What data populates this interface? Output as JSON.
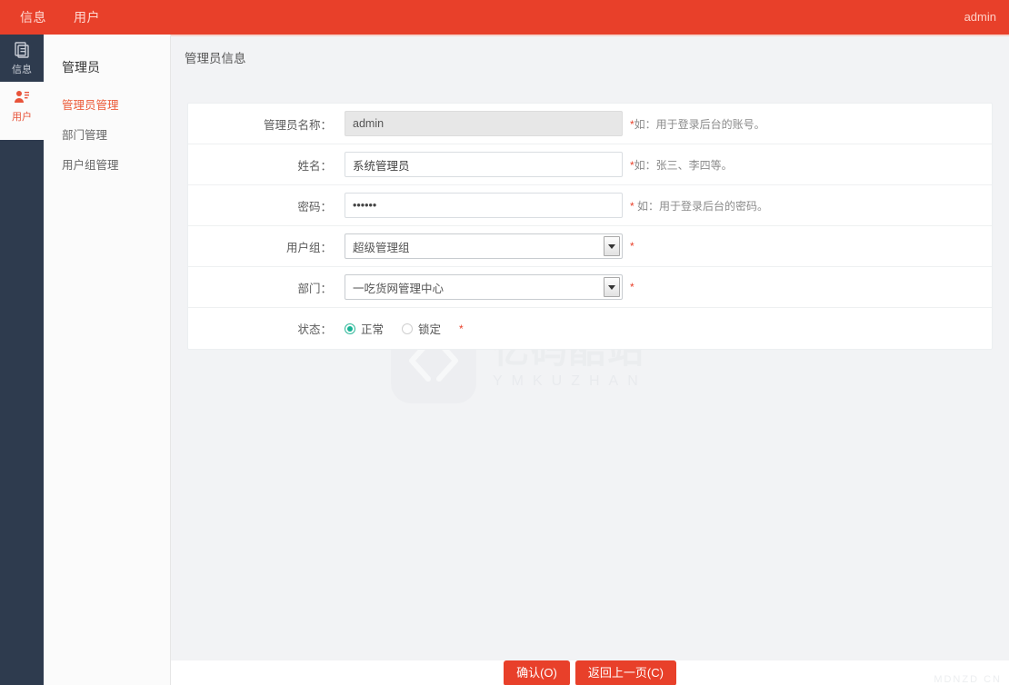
{
  "header": {
    "nav": [
      {
        "label": "信息",
        "icon": "info-tab"
      },
      {
        "label": "用户",
        "icon": "user-tab"
      }
    ],
    "account": "admin"
  },
  "rail": {
    "items": [
      {
        "label": "信息",
        "icon": "document-icon",
        "active": true
      },
      {
        "label": "用户",
        "icon": "user-card-icon",
        "active": false
      }
    ]
  },
  "submenu": {
    "title": "管理员",
    "items": [
      {
        "label": "管理员管理",
        "active": true
      },
      {
        "label": "部门管理",
        "active": false
      },
      {
        "label": "用户组管理",
        "active": false
      }
    ]
  },
  "content": {
    "title": "管理员信息"
  },
  "form": {
    "rows": [
      {
        "label": "管理员名称：",
        "type": "text",
        "value": "admin",
        "disabled": true,
        "required_star": "*",
        "hint": "如：用于登录后台的账号。"
      },
      {
        "label": "姓名：",
        "type": "text",
        "value": "系统管理员",
        "disabled": false,
        "required_star": "*",
        "hint": "如：张三、李四等。"
      },
      {
        "label": "密码：",
        "type": "password",
        "value": "••••••",
        "disabled": false,
        "required_star": "*",
        "hint": "如：用于登录后台的密码。"
      },
      {
        "label": "用户组：",
        "type": "select",
        "value": "超级管理组",
        "required_star": "*",
        "hint": ""
      },
      {
        "label": "部门：",
        "type": "select",
        "value": "一吃货网管理中心",
        "required_star": "*",
        "hint": ""
      },
      {
        "label": "状态：",
        "type": "radio",
        "required_star": "*",
        "options": [
          {
            "label": "正常",
            "selected": true
          },
          {
            "label": "锁定",
            "selected": false
          }
        ]
      }
    ]
  },
  "footer": {
    "confirm_label": "确认(O)",
    "back_label": "返回上一页(C)",
    "mark": "MDNZD CN"
  },
  "watermark": {
    "cn": "亿码酷站",
    "en": "YMKUZHAN"
  },
  "colors": {
    "brand_red": "#e8402a",
    "rail_dark": "#2e3b4e",
    "accent_link": "#ec5c3a",
    "radio_on": "#18b394",
    "page_bg": "#f2f3f5"
  }
}
